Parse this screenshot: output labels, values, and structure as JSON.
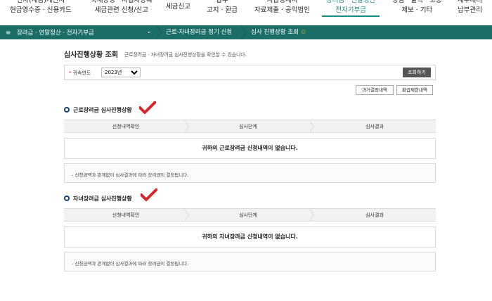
{
  "top_nav": [
    {
      "line1": "전자(세금)계산서",
      "line2": "현금영수증 · 신용카드"
    },
    {
      "line1": "국세증명 · 사업자등록",
      "line2": "세금관련 신청/신고"
    },
    {
      "line1": "세금신고",
      "line2": ""
    },
    {
      "line1": "납부",
      "line2": "고지 · 환급"
    },
    {
      "line1": "지급명세서",
      "line2": "자료제출 · 공익법인"
    },
    {
      "line1": "장려금 · 연말정산",
      "line2": "전자기부금"
    },
    {
      "line1": "상담 · 불복 · 고충",
      "line2": "제보 · 기타"
    },
    {
      "line1": "세무대리",
      "line2": "납부관리"
    }
  ],
  "breadcrumb": {
    "menu_label": "장려금 · 연말정산 · 전자기부금",
    "dropdown_glyph": "⌄",
    "level2": "근로·자녀장려금 정기 신청",
    "level3": "심사 진행상황 조회",
    "star": "✩"
  },
  "page": {
    "title": "심사진행상황 조회",
    "description": "근로장려금 · 자녀장려금 심사진행상황을 확인할 수 있습니다."
  },
  "search": {
    "label": "귀속연도",
    "required_mark": "*",
    "year_options": [
      "2023년"
    ],
    "selected_year": "2023년",
    "search_button": "조회하기"
  },
  "buttons": {
    "overpayment": "과거결정내역",
    "refund_limit": "환급제한내역"
  },
  "sections": [
    {
      "title": "근로장려금 심사진행상황",
      "steps": [
        "신청내역확인",
        "심사단계",
        "심사결과"
      ],
      "empty_message": "귀하의 근로장려금 신청내역이 없습니다.",
      "note": "- 신청금액과 관계없이 심사결과에 따라 장려금이 결정됩니다."
    },
    {
      "title": "자녀장려금 심사진행상황",
      "steps": [
        "신청내역확인",
        "심사단계",
        "심사결과"
      ],
      "empty_message": "귀하의 자녀장려금 신청내역이 없습니다.",
      "note": "- 신청금액과 관계없이 심사결과에 따라 장려금이 결정됩니다."
    }
  ],
  "colors": {
    "accent": "#1b8a80",
    "breadcrumb_bg": "#1a6e66",
    "check_mark": "#d9262c",
    "section_dot": "#1b3f7a",
    "search_button": "#555555"
  }
}
